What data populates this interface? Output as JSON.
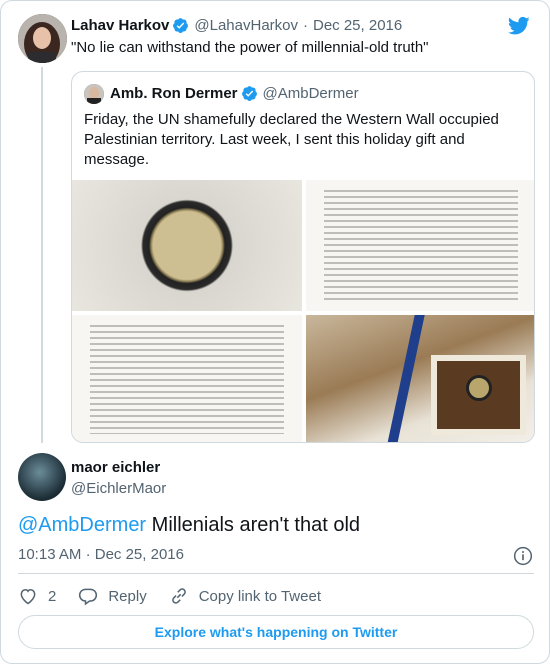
{
  "colors": {
    "accent": "#1d9bf0",
    "text": "#0f1419",
    "muted": "#536471",
    "border": "#cfd9de"
  },
  "tweet": {
    "author": {
      "name": "Lahav Harkov",
      "handle": "@LahavHarkov",
      "verified": true
    },
    "date": "Dec 25, 2016",
    "separator": "·",
    "text": "\"No lie can withstand the power of millennial-old truth\""
  },
  "quoted": {
    "author": {
      "name": "Amb. Ron Dermer",
      "handle": "@AmbDermer",
      "verified": true
    },
    "text": "Friday, the UN shamefully declared the Western Wall occupied Palestinian territory. Last week, I sent this holiday gift and message.",
    "media": [
      "coin photo",
      "letter page 1",
      "letter page 2",
      "gift box photo"
    ]
  },
  "reply": {
    "author": {
      "name": "maor eichler",
      "handle": "@EichlerMaor"
    },
    "mention": "@AmbDermer",
    "text": " Millenials aren't that old",
    "time": "10:13 AM",
    "separator": "·",
    "date": "Dec 25, 2016",
    "likes": "2",
    "reply_label": "Reply",
    "copy_label": "Copy link to Tweet"
  },
  "explore_label": "Explore what's happening on Twitter",
  "icons": [
    "twitter-bird-icon",
    "verified-icon",
    "info-icon",
    "heart-icon",
    "reply-icon",
    "link-icon"
  ]
}
